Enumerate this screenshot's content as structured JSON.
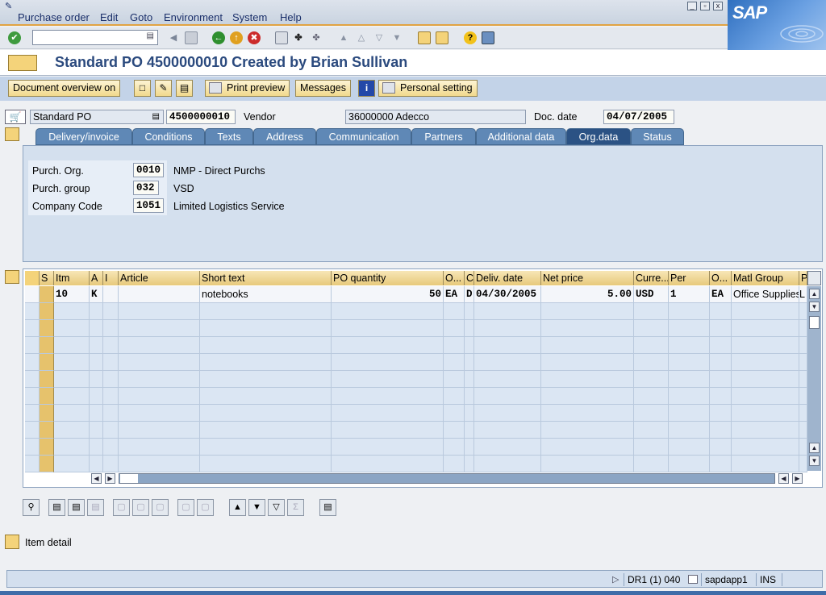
{
  "menu": [
    "Purchase order",
    "Edit",
    "Goto",
    "Environment",
    "System",
    "Help"
  ],
  "window_controls": [
    "_",
    "▫",
    "x"
  ],
  "logo": "SAP",
  "title": "Standard PO 4500000010 Created by Brian Sullivan",
  "app_toolbar": {
    "document_overview": "Document overview on",
    "print_preview": "Print preview",
    "messages": "Messages",
    "personal_setting": "Personal setting"
  },
  "header": {
    "po_type": "Standard PO",
    "po_number": "4500000010",
    "vendor_label": "Vendor",
    "vendor_value": "36000000 Adecco",
    "doc_date_label": "Doc. date",
    "doc_date_value": "04/07/2005"
  },
  "tabs": [
    "Delivery/invoice",
    "Conditions",
    "Texts",
    "Address",
    "Communication",
    "Partners",
    "Additional data",
    "Org.data",
    "Status"
  ],
  "active_tab": "Org.data",
  "org_data": {
    "purch_org_label": "Purch. Org.",
    "purch_org_value": "0010",
    "purch_org_desc": "NMP - Direct Purchs",
    "purch_group_label": "Purch. group",
    "purch_group_value": "032",
    "purch_group_desc": "VSD",
    "company_code_label": "Company Code",
    "company_code_value": "1051",
    "company_code_desc": "Limited Logistics Service"
  },
  "items_table": {
    "columns": [
      "S",
      "Itm",
      "A",
      "I",
      "Article",
      "Short text",
      "PO quantity",
      "O...",
      "C",
      "Deliv. date",
      "Net price",
      "Curre...",
      "Per",
      "O...",
      "Matl Group",
      "P"
    ],
    "rows": [
      {
        "itm": "10",
        "a": "K",
        "short_text": "notebooks",
        "po_quantity": "50",
        "oun": "EA",
        "c": "D",
        "deliv_date": "04/30/2005",
        "net_price": "5.00",
        "currency": "USD",
        "per": "1",
        "opu": "EA",
        "matl_group": "Office Supplies",
        "p": "L"
      }
    ]
  },
  "item_detail": "Item detail",
  "status_bar": {
    "system": "DR1 (1) 040",
    "server": "sapdapp1",
    "mode": "INS"
  }
}
